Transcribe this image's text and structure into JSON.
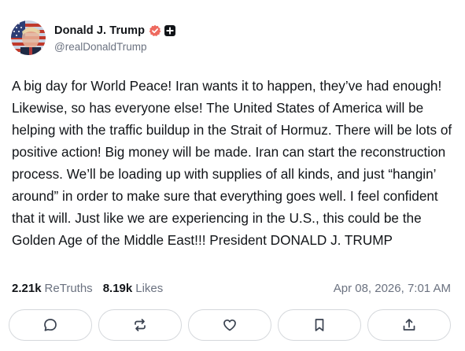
{
  "author": {
    "display_name": "Donald J. Trump",
    "handle": "@realDonaldTrump",
    "avatar_icon": "flag-portrait-avatar",
    "verified_icon": "verified-badge-icon",
    "verified_color": "#ee6a5f",
    "plus_icon": "truth-plus-badge-icon"
  },
  "post": {
    "text": "A big day for World Peace! Iran wants it to happen, they’ve had enough! Likewise, so has everyone else! The United States of America will be helping with the traffic buildup in the Strait of Hormuz. There will be lots of positive action! Big money will be made. Iran can start the reconstruction process. We’ll be loading up with supplies of all kinds, and just “hangin’ around” in order to make sure that everything goes well. I feel confident that it will. Just like we are experiencing in the U.S., this could be the Golden Age of the Middle East!!! President DONALD J. TRUMP",
    "retruths_count": "2.21k",
    "retruths_label": "ReTruths",
    "likes_count": "8.19k",
    "likes_label": "Likes",
    "timestamp": "Apr 08, 2026, 7:01 AM"
  },
  "actions": [
    {
      "name": "reply",
      "icon": "comment-icon"
    },
    {
      "name": "retruth",
      "icon": "repost-icon"
    },
    {
      "name": "like",
      "icon": "heart-icon"
    },
    {
      "name": "bookmark",
      "icon": "bookmark-icon"
    },
    {
      "name": "share",
      "icon": "share-icon"
    }
  ],
  "colors": {
    "text": "#111418",
    "muted": "#6b7280",
    "border": "#d5d8dc"
  }
}
